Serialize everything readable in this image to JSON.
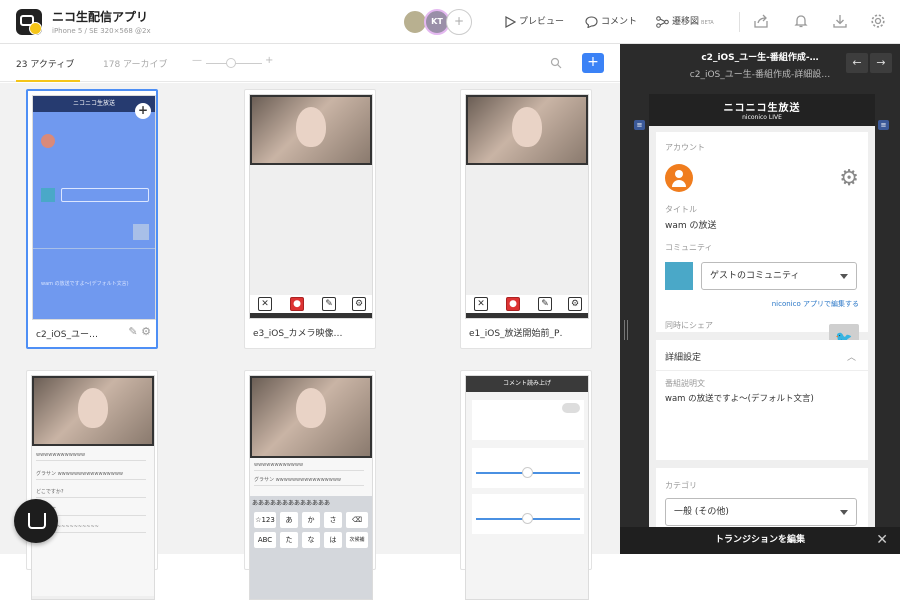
{
  "app": {
    "title": "ニコ生配信アプリ",
    "subtitle": "iPhone 5 / SE   320×568 @2x"
  },
  "collab": {
    "initials": "KT",
    "add": "+"
  },
  "actions": {
    "preview": "プレビュー",
    "comment": "コメント",
    "flow": "遷移図",
    "beta": "BETA"
  },
  "list": {
    "tab_active": "23 アクティブ",
    "tab_archive": "178 アーカイブ",
    "zoom_minus": "—",
    "zoom_plus": "+",
    "add": "+"
  },
  "cards": [
    {
      "name": "c2_iOS_ユー…",
      "header": "ニコニコ生放送"
    },
    {
      "name": "e3_iOS_カメラ映像…"
    },
    {
      "name": "e1_iOS_放送開始前_P…"
    },
    {
      "name": ""
    },
    {
      "name": ""
    },
    {
      "name": "",
      "header": "コメント読み上げ"
    }
  ],
  "kbd": {
    "row1": [
      "☆123",
      "あ",
      "か",
      "さ",
      "⌫"
    ],
    "row2": [
      "ABC",
      "た",
      "な",
      "は",
      "次候補"
    ],
    "input": "あああああああああああああ"
  },
  "panel": {
    "title": "c2_iOS_ユー生-番組作成-…",
    "subtitle": "c2_iOS_ユー生-番組作成-詳細設…",
    "phone_header": "ニコニコ生放送",
    "phone_header_sub": "niconico LIVE",
    "account_label": "アカウント",
    "title_label": "タイトル",
    "title_value": "wam の放送",
    "community_label": "コミュニティ",
    "community_value": "ゲストのコミュニティ",
    "edit_link": "niconico アプリで編集する",
    "share_label": "同時にシェア",
    "advanced_label": "詳細設定",
    "desc_label": "番組説明文",
    "desc_value": "wam の放送ですよ〜(デフォルト文言)",
    "category_label": "カテゴリ",
    "category_value": "一般 (その他)",
    "bottom": "トランジションを編集"
  }
}
